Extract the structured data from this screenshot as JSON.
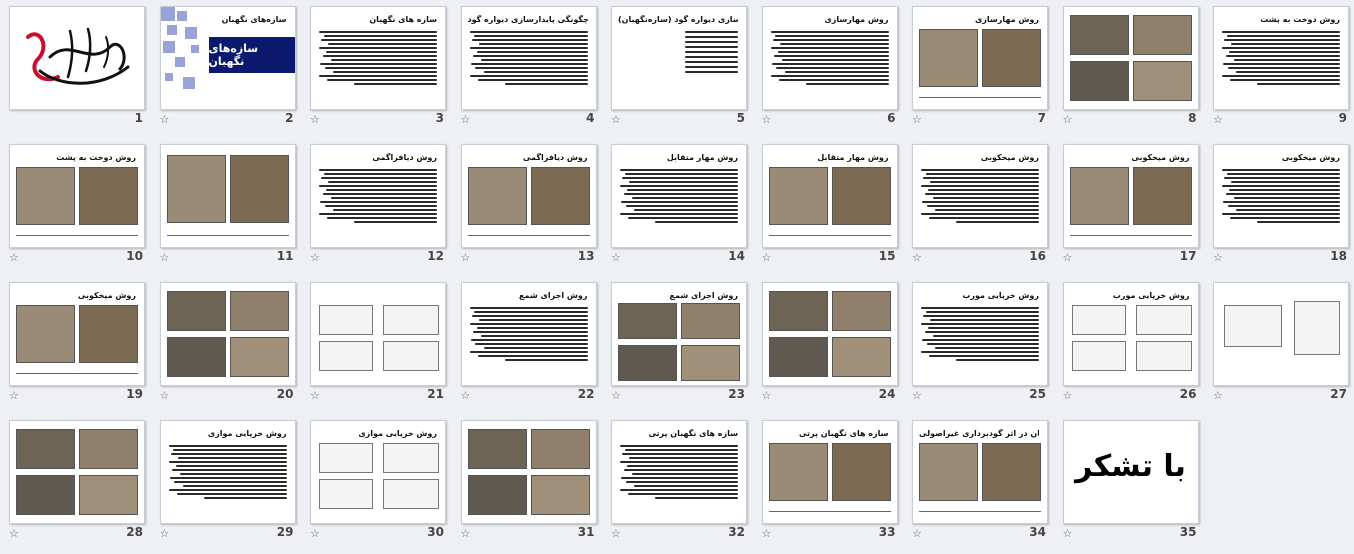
{
  "slides": [
    {
      "num": "1",
      "title": "",
      "kind": "callig"
    },
    {
      "num": "2",
      "title": "سازه‌های نگهبان",
      "kind": "cover"
    },
    {
      "num": "3",
      "title": "سازه های نگهبان",
      "kind": "text"
    },
    {
      "num": "4",
      "title": "چگونگی پایدارسازی دیواره گود",
      "kind": "text"
    },
    {
      "num": "5",
      "title": "روش های پایدار سازی دیواره گود (سازه‌نگهبان)",
      "kind": "list"
    },
    {
      "num": "6",
      "title": "روش مهارسازی",
      "kind": "text"
    },
    {
      "num": "7",
      "title": "روش مهارسازی",
      "kind": "pics2"
    },
    {
      "num": "8",
      "title": "",
      "kind": "pics4"
    },
    {
      "num": "9",
      "title": "روش دوخت به پشت",
      "kind": "text"
    },
    {
      "num": "10",
      "title": "روش دوخت به پشت",
      "kind": "pics2"
    },
    {
      "num": "11",
      "title": "",
      "kind": "pics2b"
    },
    {
      "num": "12",
      "title": "روش دیافراگمی",
      "kind": "text"
    },
    {
      "num": "13",
      "title": "روش دیافراگمی",
      "kind": "pics2"
    },
    {
      "num": "14",
      "title": "روش مهار متقابل",
      "kind": "text"
    },
    {
      "num": "15",
      "title": "روش مهار متقابل",
      "kind": "pics2"
    },
    {
      "num": "16",
      "title": "روش میخکوبی",
      "kind": "text"
    },
    {
      "num": "17",
      "title": "روش میخکوبی",
      "kind": "pics2"
    },
    {
      "num": "18",
      "title": "روش میخکوبی",
      "kind": "text"
    },
    {
      "num": "19",
      "title": "روش میخکوبی",
      "kind": "pics2"
    },
    {
      "num": "20",
      "title": "",
      "kind": "pics4"
    },
    {
      "num": "21",
      "title": "",
      "kind": "diagrams"
    },
    {
      "num": "22",
      "title": "روش اجرای شمع",
      "kind": "text"
    },
    {
      "num": "23",
      "title": "روش اجرای شمع",
      "kind": "pics4"
    },
    {
      "num": "24",
      "title": "",
      "kind": "pics4"
    },
    {
      "num": "25",
      "title": "روش خرپایی مورب",
      "kind": "text"
    },
    {
      "num": "26",
      "title": "روش خرپایی مورب",
      "kind": "diagrams"
    },
    {
      "num": "27",
      "title": "",
      "kind": "diagrams2"
    },
    {
      "num": "28",
      "title": "",
      "kind": "pics4"
    },
    {
      "num": "29",
      "title": "روش خرپایی موازی",
      "kind": "text"
    },
    {
      "num": "30",
      "title": "روش خرپایی موازی",
      "kind": "diagrams"
    },
    {
      "num": "31",
      "title": "",
      "kind": "pics4"
    },
    {
      "num": "32",
      "title": "سازه های نگهبان پرتی",
      "kind": "text"
    },
    {
      "num": "33",
      "title": "سازه های نگهبان پرتی",
      "kind": "pics2"
    },
    {
      "num": "34",
      "title": "تخریب ساختمان در اثر گودبرداری غیراصولی",
      "kind": "pics2"
    },
    {
      "num": "35",
      "title": "",
      "kind": "thanks"
    }
  ],
  "cover_title": "سازه‌های نگهبان",
  "thanks_text": "با تشکر"
}
